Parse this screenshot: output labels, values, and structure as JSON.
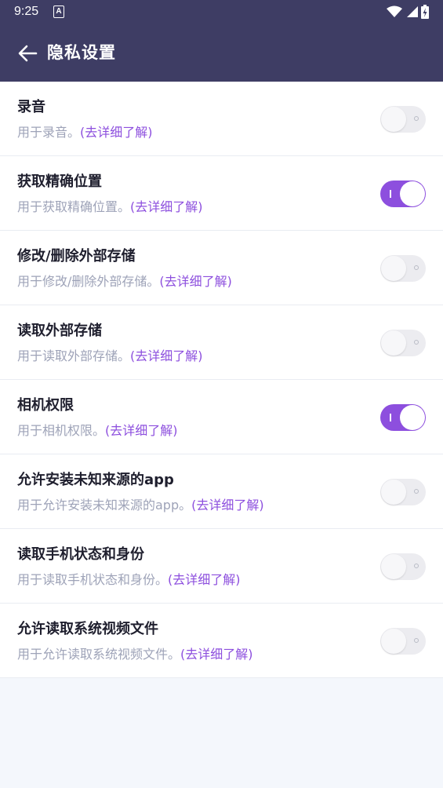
{
  "status_bar": {
    "time": "9:25",
    "notification_letter": "A",
    "icons": [
      "wifi-icon",
      "signal-icon",
      "battery-icon"
    ]
  },
  "header": {
    "title": "隐私设置",
    "back_icon": "arrow-left-icon"
  },
  "colors": {
    "header_bg": "#3e3d64",
    "accent": "#8d4fde",
    "page_bg": "#f4f7fc"
  },
  "permissions": [
    {
      "title": "录音",
      "desc": "用于录音。",
      "link": "(去详细了解)",
      "enabled": false
    },
    {
      "title": "获取精确位置",
      "desc": "用于获取精确位置。",
      "link": "(去详细了解)",
      "enabled": true
    },
    {
      "title": "修改/删除外部存储",
      "desc": "用于修改/删除外部存储。",
      "link": "(去详细了解)",
      "enabled": false
    },
    {
      "title": "读取外部存储",
      "desc": "用于读取外部存储。",
      "link": "(去详细了解)",
      "enabled": false
    },
    {
      "title": "相机权限",
      "desc": "用于相机权限。",
      "link": "(去详细了解)",
      "enabled": true
    },
    {
      "title": "允许安装未知来源的app",
      "desc": "用于允许安装未知来源的app。",
      "link": "(去详细了解)",
      "enabled": false
    },
    {
      "title": "读取手机状态和身份",
      "desc": "用于读取手机状态和身份。",
      "link": "(去详细了解)",
      "enabled": false
    },
    {
      "title": "允许读取系统视频文件",
      "desc": "用于允许读取系统视频文件。",
      "link": "(去详细了解)",
      "enabled": false
    }
  ]
}
